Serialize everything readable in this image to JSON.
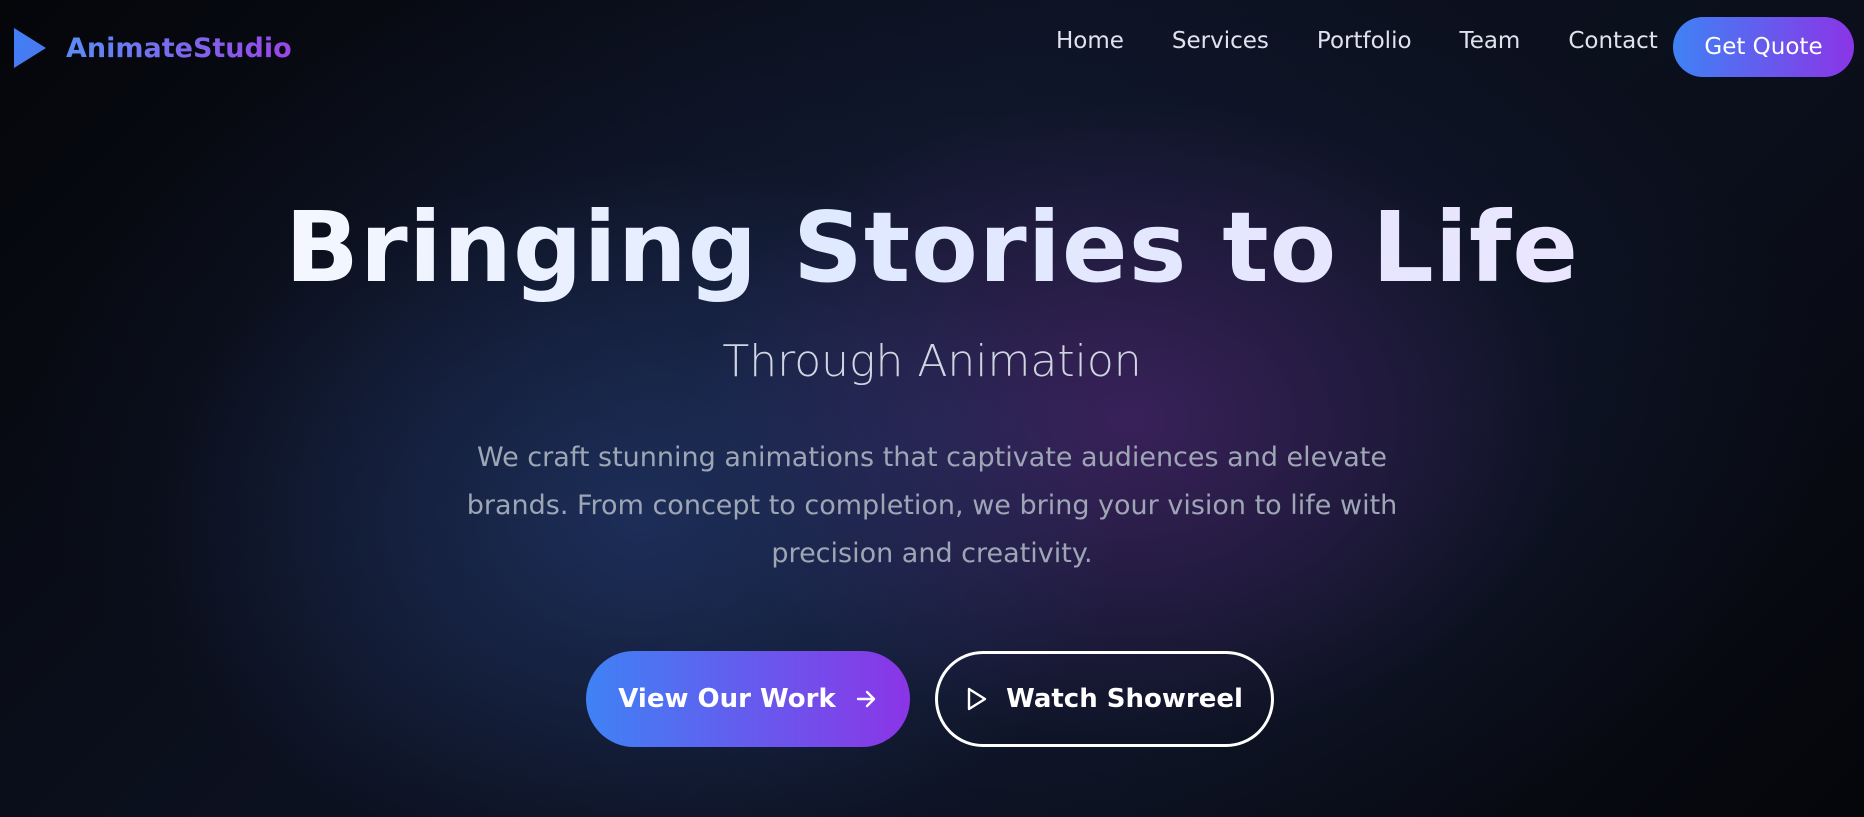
{
  "brand": {
    "name": "AnimateStudio",
    "icon": "play-triangle-icon"
  },
  "nav": {
    "links": [
      "Home",
      "Services",
      "Portfolio",
      "Team",
      "Contact"
    ],
    "cta_label": "Get Quote"
  },
  "hero": {
    "title": "Bringing Stories to Life",
    "subtitle": "Through Animation",
    "description": "We craft stunning animations that captivate audiences and elevate brands. From concept to completion, we bring your vision to life with precision and creativity.",
    "primary_button": {
      "label": "View Our Work",
      "icon": "arrow-right-icon"
    },
    "secondary_button": {
      "label": "Watch Showreel",
      "icon": "play-outline-icon"
    }
  },
  "colors": {
    "accent_start": "#3f82f5",
    "accent_end": "#8b35e6",
    "background": "#07080d"
  }
}
